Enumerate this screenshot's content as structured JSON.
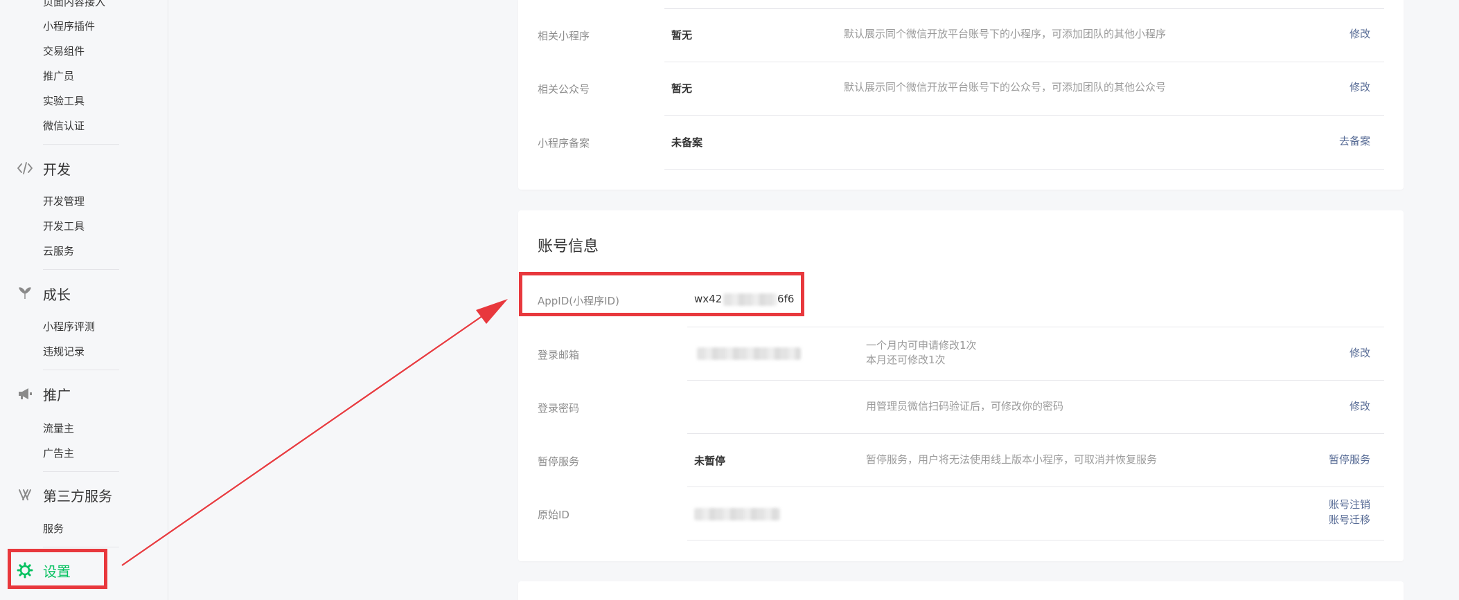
{
  "sidebar": {
    "top_partial": "页面内容接入",
    "items_top": [
      "小程序插件",
      "交易组件",
      "推广员",
      "实验工具",
      "微信认证"
    ],
    "dev": {
      "title": "开发",
      "items": [
        "开发管理",
        "开发工具",
        "云服务"
      ]
    },
    "growth": {
      "title": "成长",
      "items": [
        "小程序评测",
        "违规记录"
      ]
    },
    "promo": {
      "title": "推广",
      "items": [
        "流量主",
        "广告主"
      ]
    },
    "third": {
      "title": "第三方服务",
      "items": [
        "服务"
      ]
    },
    "settings": {
      "title": "设置"
    }
  },
  "related": {
    "rows": [
      {
        "label": "相关小程序",
        "value": "暂无",
        "desc": "默认展示同个微信开放平台账号下的小程序，可添加团队的其他小程序",
        "action": "修改"
      },
      {
        "label": "相关公众号",
        "value": "暂无",
        "desc": "默认展示同个微信开放平台账号下的公众号，可添加团队的其他公众号",
        "action": "修改"
      },
      {
        "label": "小程序备案",
        "value": "未备案",
        "desc": "",
        "action": "去备案"
      }
    ]
  },
  "account": {
    "title": "账号信息",
    "appid": {
      "label": "AppID(小程序ID)",
      "value_start": "wx42",
      "value_end": "6f6"
    },
    "email": {
      "label": "登录邮箱",
      "desc_line1": "一个月内可申请修改1次",
      "desc_line2": "本月还可修改1次",
      "action": "修改"
    },
    "password": {
      "label": "登录密码",
      "desc": "用管理员微信扫码验证后，可修改你的密码",
      "action": "修改"
    },
    "suspend": {
      "label": "暂停服务",
      "value": "未暂停",
      "desc": "暂停服务，用户将无法使用线上版本小程序，可取消并恢复服务",
      "action": "暂停服务"
    },
    "origin": {
      "label": "原始ID",
      "action1": "账号注销",
      "action2": "账号迁移"
    }
  },
  "colors": {
    "accent_green": "#07c160",
    "link_blue": "#576b95",
    "highlight_red": "#e8383d"
  }
}
